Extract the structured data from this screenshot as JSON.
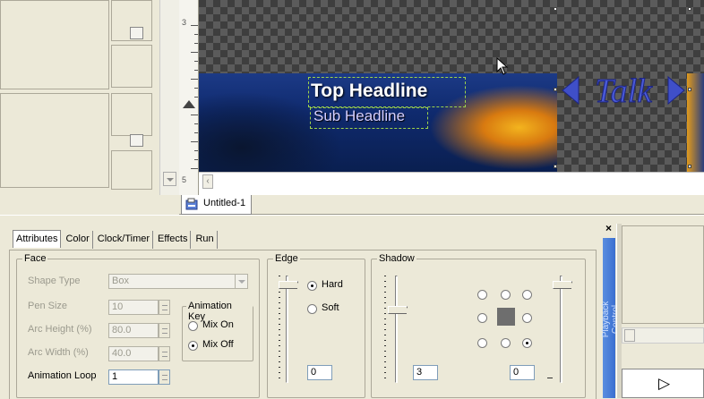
{
  "canvas": {
    "top_headline": "Top Headline",
    "sub_headline": "Sub Headline",
    "logo_text": "Talk"
  },
  "ruler": {
    "marks": [
      "3",
      "5"
    ]
  },
  "document_tab": {
    "label": "Untitled-1"
  },
  "attribute_tabs": [
    "Attributes",
    "Color",
    "Clock/Timer",
    "Effects",
    "Run"
  ],
  "face": {
    "group_label": "Face",
    "shape_type_label": "Shape Type",
    "shape_type_value": "Box",
    "pen_size_label": "Pen Size",
    "pen_size_value": "10",
    "arc_height_label": "Arc Height (%)",
    "arc_height_value": "80.0",
    "arc_width_label": "Arc Width (%)",
    "arc_width_value": "40.0",
    "animation_loop_label": "Animation Loop",
    "animation_loop_value": "1",
    "animation_key": {
      "label": "Animation Key",
      "options": [
        "Mix On",
        "Mix Off"
      ],
      "selected": "Mix Off"
    }
  },
  "edge": {
    "group_label": "Edge",
    "options": [
      "Hard",
      "Soft"
    ],
    "selected": "Hard",
    "value": "0"
  },
  "shadow": {
    "group_label": "Shadow",
    "value_left": "3",
    "value_right": "0",
    "selected_direction": "bottom-right"
  },
  "playback": {
    "close_glyph": "×",
    "label": "Playback Control",
    "play_glyph": "▷"
  },
  "colors": {
    "face": "#ece9d8",
    "canvas_dark": "#3e3e3e",
    "banner": "#1c3a86",
    "accent_orange": "#f3b41e",
    "playback_blue": "#3b6fd0"
  }
}
